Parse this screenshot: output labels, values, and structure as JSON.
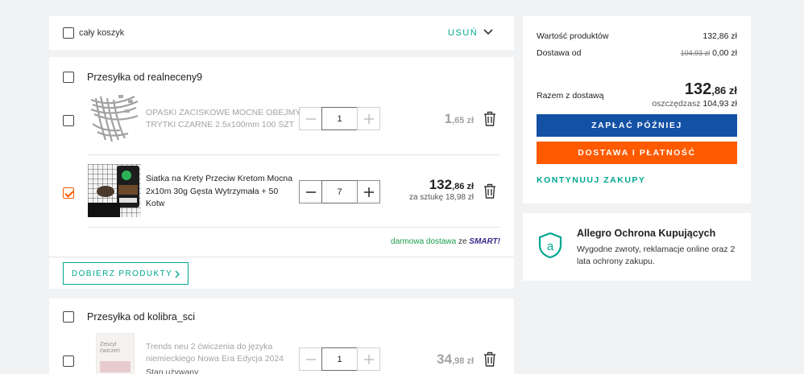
{
  "cart": {
    "select_all_label": "cały koszyk",
    "remove_label": "USUŃ"
  },
  "shipments": [
    {
      "seller_label": "Przesyłka od realneceny9",
      "items": [
        {
          "title_line1": "OPASKI ZACISKOWE MOCNE OBEJMY",
          "title_line2": "TRYTKI CZARNE 2.5x100mm 100 SZT",
          "quantity": "1",
          "price_main": "1",
          "price_cents": ",65 zł",
          "checked": false,
          "available": false
        },
        {
          "title_line1": "Siatka na Krety Przeciw Kretom Mocna",
          "title_line2": "2x10m 30g Gęsta Wytrzymała + 50",
          "title_line3": "Kotw",
          "quantity": "7",
          "price_main": "132",
          "price_cents": ",86 zł",
          "unit_price": "za sztukę 18,98 zł",
          "checked": true,
          "available": true
        }
      ],
      "free_shipping_label": "darmowa dostawa",
      "free_shipping_with": "ze",
      "smart_label": "SMART!",
      "add_products_label": "DOBIERZ PRODUKTY"
    },
    {
      "seller_label": "Przesyłka od kolibra_sci",
      "items": [
        {
          "title_line1": "Trends neu 2 ćwiczenia do języka",
          "title_line2": "niemieckiego Nowa Era Edycja 2024",
          "condition": "Stan używany",
          "thumb_text_1": "Zeszyt",
          "thumb_text_2": "ćwiczeń",
          "quantity": "1",
          "price_main": "34",
          "price_cents": ",98 zł",
          "checked": false,
          "available": false
        }
      ]
    }
  ],
  "summary": {
    "products_value_label": "Wartość produktów",
    "products_value": "132,86 zł",
    "delivery_label": "Dostawa od",
    "delivery_old": "104,93 zł",
    "delivery_value": "0,00 zł",
    "total_label": "Razem z dostawą",
    "total_main": "132",
    "total_cents": ",86 zł",
    "savings_label": "oszczędzasz",
    "savings_value": "104,93 zł",
    "pay_later_label": "ZAPŁAĆ PÓŹNIEJ",
    "delivery_payment_label": "DOSTAWA I PŁATNOŚĆ",
    "continue_label": "KONTYNUUJ ZAKUPY"
  },
  "protection": {
    "title": "Allegro Ochrona Kupujących",
    "line1": "Wygodne zwroty, reklamacje online oraz 2",
    "line2": "lata ochrony zakupu."
  },
  "colors": {
    "accent_orange": "#ff5a00",
    "accent_blue": "#1351a5",
    "accent_teal": "#00a790",
    "free_shipping_green": "#1a9b4b",
    "smart_purple": "#3b2a8a"
  }
}
